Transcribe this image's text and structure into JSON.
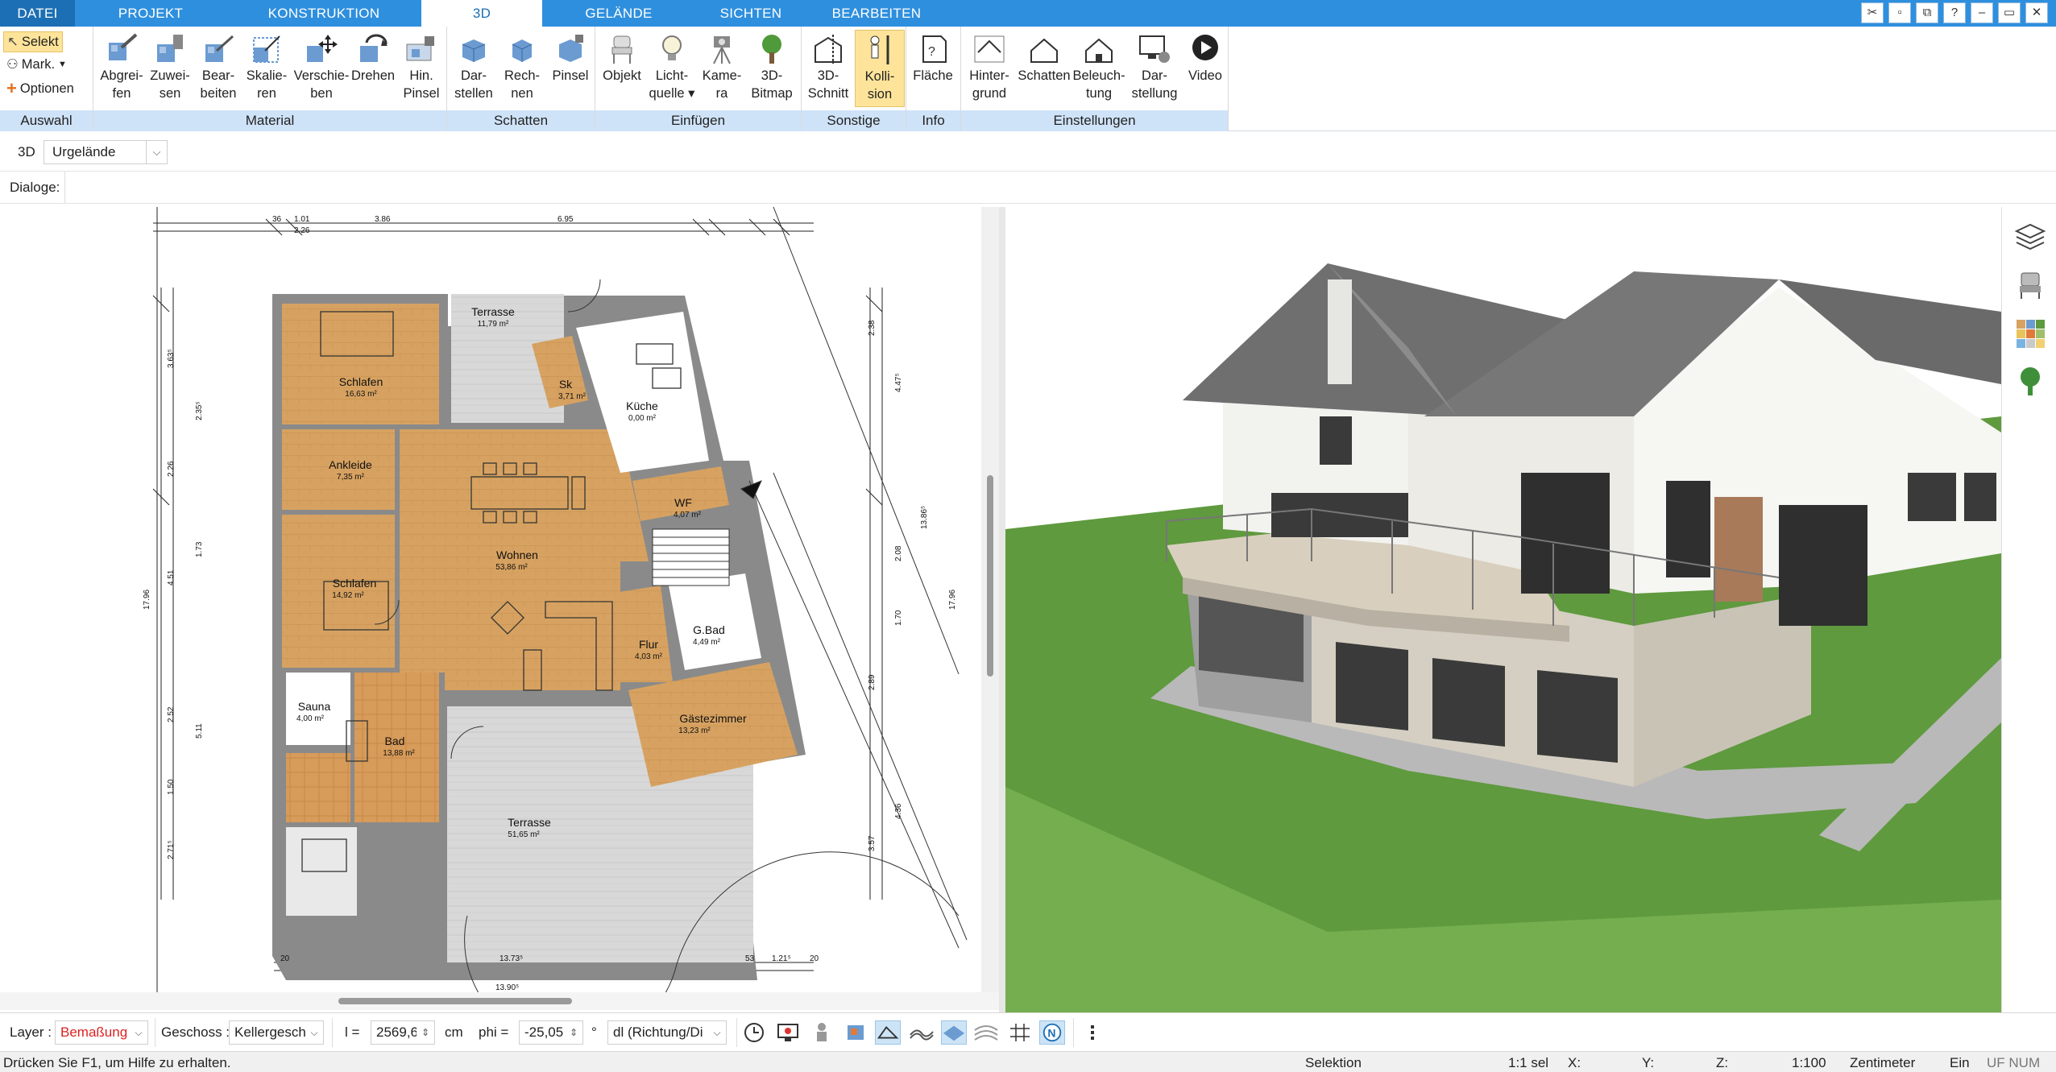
{
  "menu": {
    "tabs": [
      "DATEI",
      "PROJEKT",
      "KONSTRUKTION",
      "3D",
      "GELÄNDE",
      "SICHTEN",
      "BEARBEITEN"
    ],
    "active": "3D"
  },
  "ribbon": {
    "auswahl": {
      "select": "Selekt",
      "mark": "Mark.",
      "options": "Optionen",
      "label": "Auswahl"
    },
    "material": {
      "label": "Material",
      "buttons": [
        {
          "l1": "Abgrei-",
          "l2": "fen"
        },
        {
          "l1": "Zuwei-",
          "l2": "sen"
        },
        {
          "l1": "Bear-",
          "l2": "beiten"
        },
        {
          "l1": "Skalie-",
          "l2": "ren"
        },
        {
          "l1": "Verschie-",
          "l2": "ben"
        },
        {
          "l1": "Drehen",
          "l2": ""
        },
        {
          "l1": "Hin.",
          "l2": "Pinsel"
        }
      ]
    },
    "schatten": {
      "label": "Schatten",
      "buttons": [
        {
          "l1": "Dar-",
          "l2": "stellen"
        },
        {
          "l1": "Rech-",
          "l2": "nen"
        },
        {
          "l1": "Pinsel",
          "l2": ""
        }
      ]
    },
    "einfuegen": {
      "label": "Einfügen",
      "buttons": [
        {
          "l1": "Objekt",
          "l2": ""
        },
        {
          "l1": "Licht-",
          "l2": "quelle ▾"
        },
        {
          "l1": "Kame-",
          "l2": "ra"
        },
        {
          "l1": "3D-",
          "l2": "Bitmap"
        }
      ]
    },
    "sonstige": {
      "label": "Sonstige",
      "buttons": [
        {
          "l1": "3D-",
          "l2": "Schnitt"
        },
        {
          "l1": "Kolli-",
          "l2": "sion"
        }
      ]
    },
    "info": {
      "label": "Info",
      "buttons": [
        {
          "l1": "Fläche",
          "l2": ""
        }
      ]
    },
    "einstellungen": {
      "label": "Einstellungen",
      "buttons": [
        {
          "l1": "Hinter-",
          "l2": "grund"
        },
        {
          "l1": "Schatten",
          "l2": ""
        },
        {
          "l1": "Beleuch-",
          "l2": "tung"
        },
        {
          "l1": "Dar-",
          "l2": "stellung"
        },
        {
          "l1": "Video",
          "l2": ""
        }
      ]
    }
  },
  "bar3d": {
    "label": "3D",
    "terrain": "Urgelände"
  },
  "dialogs": {
    "label": "Dialoge:"
  },
  "plan": {
    "rooms": [
      {
        "name": "Terrasse",
        "area": "11,79 m²"
      },
      {
        "name": "Schlafen",
        "area": "16,63 m²"
      },
      {
        "name": "Sk",
        "area": "3,71 m²"
      },
      {
        "name": "Küche",
        "area": "0,00 m²"
      },
      {
        "name": "Ankleide",
        "area": "7,35 m²"
      },
      {
        "name": "WF",
        "area": "4,07 m²"
      },
      {
        "name": "Wohnen",
        "area": "53,86 m²"
      },
      {
        "name": "Schlafen",
        "area": "14,92 m²"
      },
      {
        "name": "G.Bad",
        "area": "4,49 m²"
      },
      {
        "name": "Flur",
        "area": "4,03 m²"
      },
      {
        "name": "Gästezimmer",
        "area": "13,23 m²"
      },
      {
        "name": "Sauna",
        "area": "4,00 m²"
      },
      {
        "name": "Bad",
        "area": "13,88 m²"
      },
      {
        "name": "Terrasse",
        "area": "51,65 m²"
      }
    ],
    "dims_top": [
      "36",
      "1.01",
      "2.26",
      "3.86",
      "6.95"
    ],
    "dims_bottom": [
      "20",
      "13.73⁵",
      "13.90⁵",
      "53",
      "1.21⁵",
      "20"
    ],
    "dims_left": [
      "17.96",
      "4.51",
      "5.11",
      "2.52",
      "1.50",
      "2.71⁵",
      "3.63⁵",
      "2.35⁵",
      "2.26",
      "1.73"
    ],
    "dims_right": [
      "17.96",
      "13.86⁵",
      "4.47⁵",
      "2.38",
      "2.08",
      "1.70",
      "2.89",
      "3.57",
      "4.36"
    ]
  },
  "bottom": {
    "layer_label": "Layer :",
    "layer_value": "Bemaßung",
    "geschoss_label": "Geschoss :",
    "geschoss_value": "Kellergesch",
    "l_label": "l =",
    "l_value": "2569,6",
    "l_unit": "cm",
    "phi_label": "phi =",
    "phi_value": "-25,05",
    "phi_unit": "°",
    "dl_value": "dl (Richtung/Di"
  },
  "status": {
    "hint": "Drücken Sie F1, um Hilfe zu erhalten.",
    "mode": "Selektion",
    "sel": "1:1 sel",
    "x": "X:",
    "y": "Y:",
    "z": "Z:",
    "scale": "1:100",
    "unit": "Zentimeter",
    "ein": "Ein",
    "flags": "UF NUM RF"
  },
  "colors": {
    "menubar": "#2e8fde",
    "ribbon_group": "#cfe3f8",
    "highlight": "#fde49a",
    "floor": "#d9a464",
    "grass": "#5f9a3e",
    "roof": "#6f6f6f"
  }
}
